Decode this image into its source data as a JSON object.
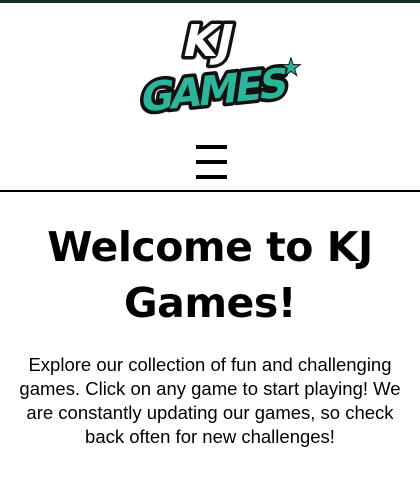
{
  "header": {
    "logo": {
      "line1": "KJ",
      "line2": "GAMES",
      "star": "★",
      "colors": {
        "accent": "#2bb59a",
        "ink": "#111111",
        "outline": "#ffffff"
      }
    },
    "menu_icon": "hamburger-menu-icon"
  },
  "main": {
    "title": "Welcome to KJ Games!",
    "intro": "Explore our collection of fun and challenging games. Click on any game to start playing! We are constantly updating our games, so check back often for new challenges!"
  }
}
